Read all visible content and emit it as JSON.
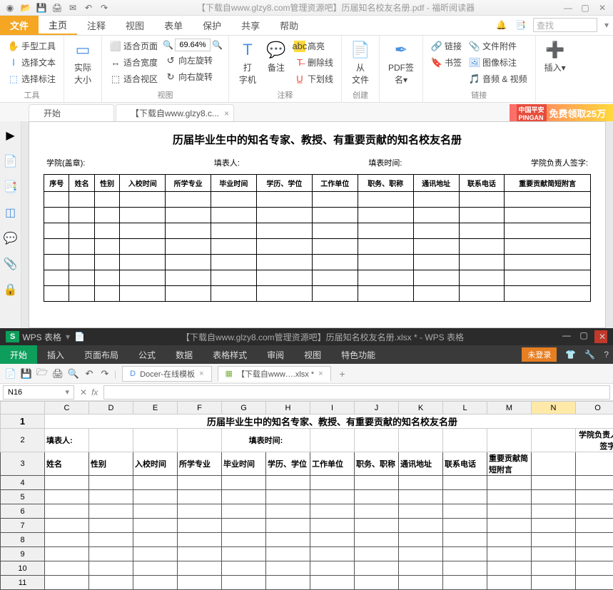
{
  "pdf": {
    "title": "【下载自www.glzy8.com管理资源吧】历届知名校友名册.pdf - 福昕阅读器",
    "search_placeholder": "查找",
    "menus": {
      "file": "文件",
      "home": "主页",
      "annot": "注释",
      "view": "视图",
      "form": "表单",
      "protect": "保护",
      "share": "共享",
      "help": "帮助"
    },
    "ribbon": {
      "tools": {
        "hand": "手型工具",
        "seltext": "选择文本",
        "selannot": "选择标注",
        "label": "工具"
      },
      "actual": {
        "actualsize": "实际\n大小"
      },
      "fit": {
        "page": "适合页面",
        "width": "适合宽度",
        "view": "适合视区",
        "label": "视图"
      },
      "zoom": {
        "value": "69.64%"
      },
      "rotate": {
        "left": "向左旋转",
        "right": "向右旋转"
      },
      "typewriter": {
        "label": "打\n字机"
      },
      "note": {
        "label": "备注"
      },
      "highlight": {
        "hl": "高亮",
        "strike": "删除线",
        "under": "下划线",
        "label": "注释"
      },
      "fromfile": {
        "label": "从\n文件",
        "sub": "创建"
      },
      "sign": {
        "label": "PDF签\n名▾"
      },
      "links": {
        "link": "链接",
        "bookmark": "书签",
        "imgannot": "图像标注",
        "av": "音频 & 视频",
        "fileatt": "文件附件",
        "label": "链接"
      }
    },
    "doctabs": {
      "start": "开始",
      "doc": "【下载自www.glzy8.c..."
    },
    "promo": "免费领取25万",
    "page": {
      "heading": "历届毕业生中的知名专家、教授、有重要贡献的知名校友名册",
      "meta": {
        "college": "学院(盖章):",
        "filler": "填表人:",
        "filltime": "填表时间:",
        "head": "学院负责人签字:"
      },
      "cols": [
        "序号",
        "姓名",
        "性别",
        "入校时间",
        "所学专业",
        "毕业时间",
        "学历、学位",
        "工作单位",
        "职务、职称",
        "通讯地址",
        "联系电话",
        "重要贡献简短附言"
      ]
    }
  },
  "wps": {
    "product": "WPS 表格",
    "title": "【下载自www.glzy8.com管理资源吧】历届知名校友名册.xlsx * - WPS 表格",
    "nologin": "未登录",
    "menus": [
      "开始",
      "插入",
      "页面布局",
      "公式",
      "数据",
      "表格样式",
      "审阅",
      "视图",
      "特色功能"
    ],
    "doctabs": {
      "docer": "Docer-在线模板",
      "xlsx": "【下载自www….xlsx *"
    },
    "namebox": "N16",
    "cols": [
      "C",
      "D",
      "E",
      "F",
      "G",
      "H",
      "I",
      "J",
      "K",
      "L",
      "M",
      "N",
      "O"
    ],
    "row1": "历届毕业生中的知名专家、教授、有重要贡献的知名校友名册",
    "row2": {
      "filler": "填表人:",
      "filltime": "填表时间:",
      "head": "学院负责人签字:"
    },
    "row3": [
      "姓名",
      "性别",
      "入校时间",
      "所学专业",
      "毕业时间",
      "学历、学位",
      "工作单位",
      "职务、职称",
      "通讯地址",
      "联系电话",
      "重要贡献简短附言"
    ]
  }
}
